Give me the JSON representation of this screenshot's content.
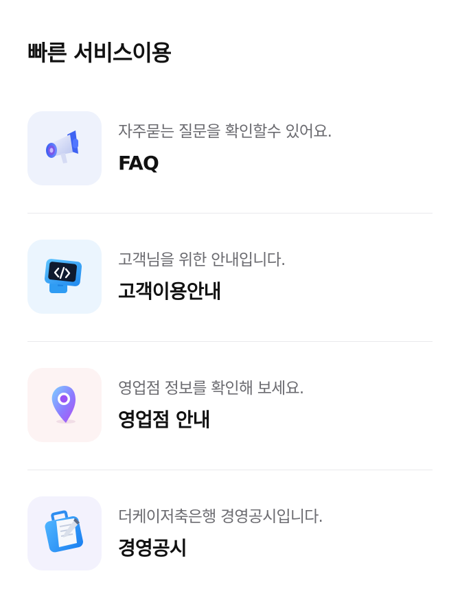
{
  "section": {
    "title": "빠른 서비스이용"
  },
  "items": [
    {
      "icon": "megaphone-icon",
      "tile_color": "#eef2fc",
      "description": "자주묻는 질문을 확인할수 있어요.",
      "title": "FAQ"
    },
    {
      "icon": "monitor-code-icon",
      "tile_color": "#ebf5fe",
      "description": "고객님을 위한 안내입니다.",
      "title": "고객이용안내"
    },
    {
      "icon": "location-pin-icon",
      "tile_color": "#fdf3f3",
      "description": "영업점 정보를 확인해 보세요.",
      "title": "영업점 안내"
    },
    {
      "icon": "document-clipboard-icon",
      "tile_color": "#f3f2fd",
      "description": "더케이저축은행 경영공시입니다.",
      "title": "경영공시"
    }
  ]
}
